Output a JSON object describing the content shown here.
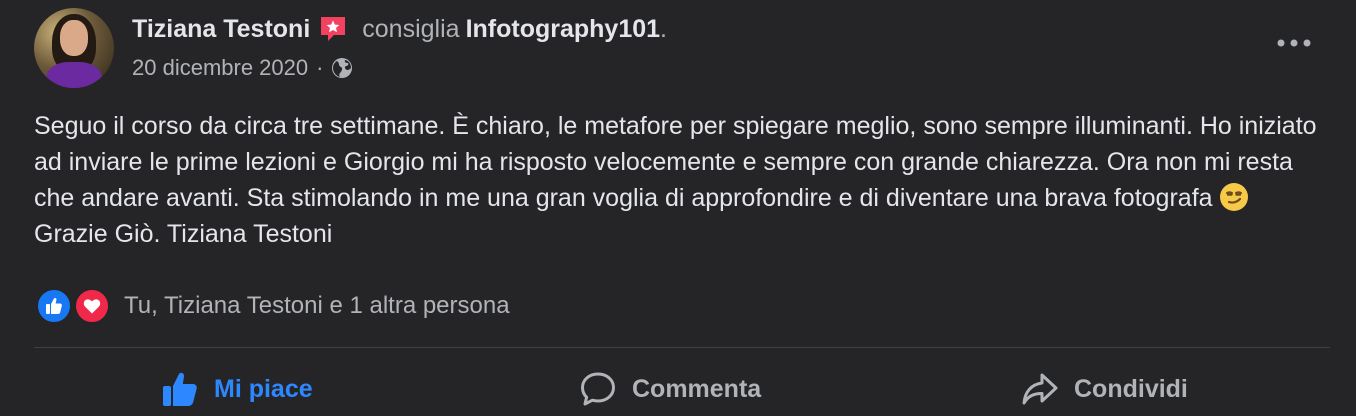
{
  "post": {
    "author": "Tiziana Testoni",
    "recommends_text": "consiglia",
    "page_name": "Infotography101",
    "page_suffix": ".",
    "date": "20 dicembre 2020",
    "meta_separator": "·",
    "audience_icon": "globe-icon",
    "text_part1": "Seguo il corso da circa tre settimane. È chiaro, le metafore per spiegare meglio, sono sempre illuminanti. Ho iniziato ad inviare le prime lezioni e Giorgio mi ha risposto velocemente e sempre con grande chiarezza. Ora non mi resta che andare avanti. Sta stimolando in me una gran voglia di approfondire e di diventare una brava fotografa",
    "text_emoji": "smirking-face-emoji",
    "text_part2": "Grazie Giò. Tiziana Testoni"
  },
  "reactions": {
    "icons": [
      "like-reaction-icon",
      "love-reaction-icon"
    ],
    "summary": "Tu, Tiziana Testoni e 1 altra persona"
  },
  "actions": {
    "like_label": "Mi piace",
    "comment_label": "Commenta",
    "share_label": "Condividi"
  },
  "colors": {
    "background": "#252527",
    "primary_text": "#e4e6eb",
    "secondary_text": "#b0b3b8",
    "like_active": "#2d88ff",
    "love": "#f0284a",
    "recommend_badge": "#f3425f"
  }
}
